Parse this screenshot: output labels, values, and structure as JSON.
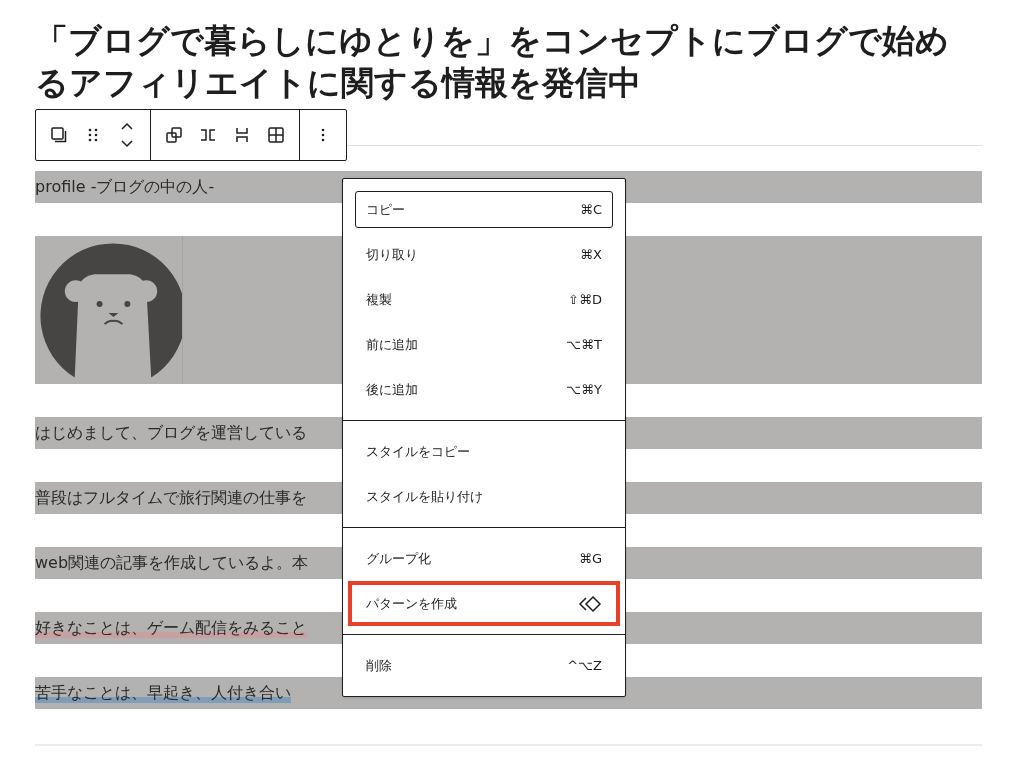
{
  "title": "「ブログで暮らしにゆとりを」をコンセプトにブログで始めるアフィリエイトに関する情報を発信中",
  "blocks": [
    {
      "kind": "text",
      "text": "profile -ブログの中の人-"
    },
    {
      "kind": "image"
    },
    {
      "kind": "text",
      "text": "はじめまして、ブログを運営している"
    },
    {
      "kind": "text",
      "text": "普段はフルタイムで旅行関連の仕事を"
    },
    {
      "kind": "text",
      "text": "web関連の記事を作成しているよ。本"
    },
    {
      "kind": "text",
      "text": "好きなことは、ゲーム配信をみること",
      "color": "#c9a0a0"
    },
    {
      "kind": "text",
      "text": "苦手なことは、早起き、人付き合い",
      "color": "#7f9db8"
    }
  ],
  "menu": {
    "groups": [
      [
        {
          "label": "コピー",
          "shortcut": "⌘C",
          "focused": true,
          "marked": false
        },
        {
          "label": "切り取り",
          "shortcut": "⌘X",
          "focused": false,
          "marked": false
        },
        {
          "label": "複製",
          "shortcut": "⇧⌘D",
          "focused": false,
          "marked": false
        },
        {
          "label": "前に追加",
          "shortcut": "⌥⌘T",
          "focused": false,
          "marked": false
        },
        {
          "label": "後に追加",
          "shortcut": "⌥⌘Y",
          "focused": false,
          "marked": false
        }
      ],
      [
        {
          "label": "スタイルをコピー",
          "focused": false,
          "marked": false
        },
        {
          "label": "スタイルを貼り付け",
          "focused": false,
          "marked": false
        }
      ],
      [
        {
          "label": "グループ化",
          "shortcut": "⌘G",
          "focused": false,
          "marked": false
        },
        {
          "label": "パターンを作成",
          "kind": "icon",
          "focused": false,
          "marked": true
        }
      ],
      [
        {
          "label": "削除",
          "shortcut": "^⌥Z",
          "focused": false,
          "marked": false
        }
      ]
    ]
  }
}
